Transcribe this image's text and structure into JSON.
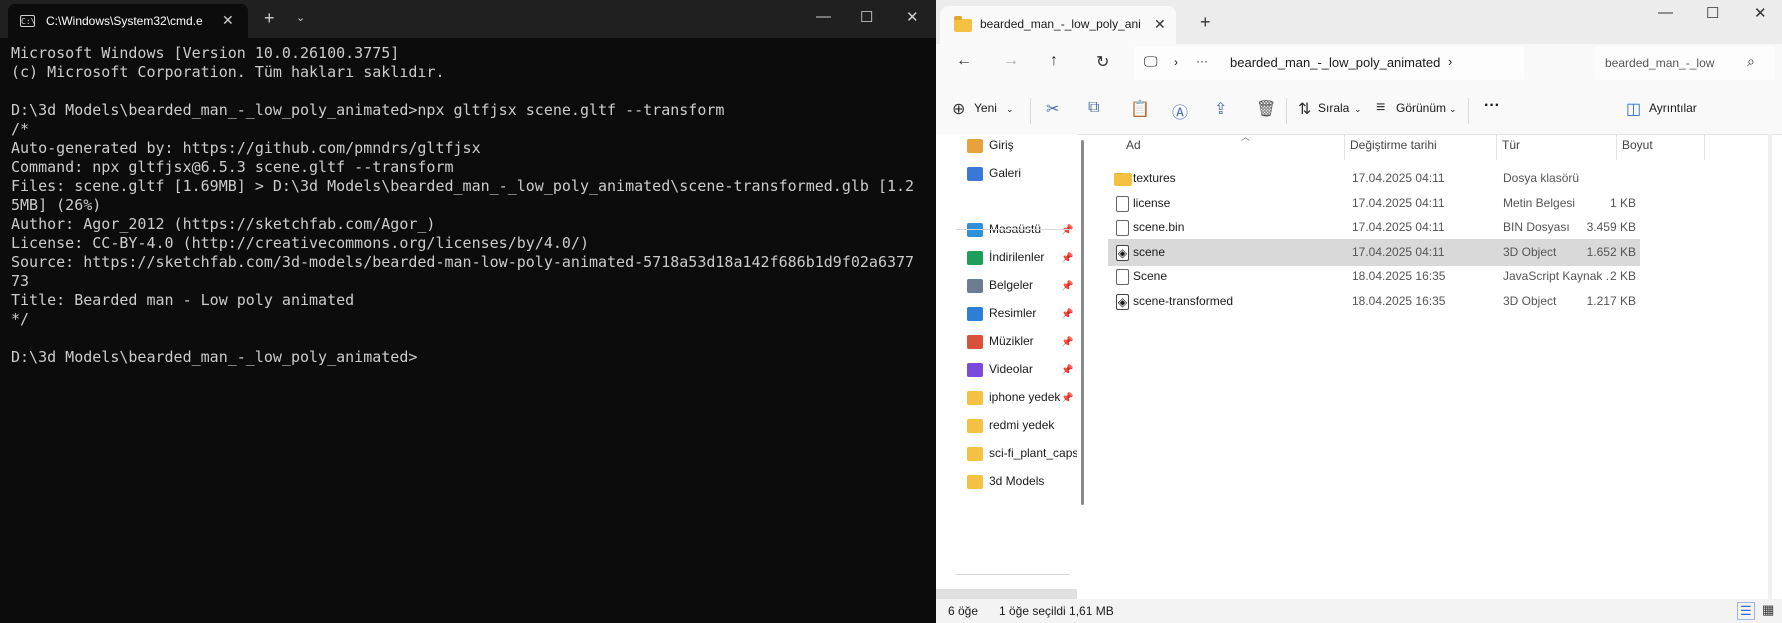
{
  "terminal": {
    "tab_title": "C:\\Windows\\System32\\cmd.e",
    "lines": [
      "Microsoft Windows [Version 10.0.26100.3775]",
      "(c) Microsoft Corporation. Tüm hakları saklıdır.",
      "",
      "D:\\3d Models\\bearded_man_-_low_poly_animated>npx gltfjsx scene.gltf --transform",
      "/*",
      "Auto-generated by: https://github.com/pmndrs/gltfjsx",
      "Command: npx gltfjsx@6.5.3 scene.gltf --transform",
      "Files: scene.gltf [1.69MB] > D:\\3d Models\\bearded_man_-_low_poly_animated\\scene-transformed.glb [1.2",
      "5MB] (26%)",
      "Author: Agor_2012 (https://sketchfab.com/Agor_)",
      "License: CC-BY-4.0 (http://creativecommons.org/licenses/by/4.0/)",
      "Source: https://sketchfab.com/3d-models/bearded-man-low-poly-animated-5718a53d18a142f686b1d9f02a6377",
      "73",
      "Title: Bearded man - Low poly animated",
      "*/",
      "",
      "D:\\3d Models\\bearded_man_-_low_poly_animated>"
    ]
  },
  "explorer": {
    "tab_title": "bearded_man_-_low_poly_anin",
    "breadcrumb": "bearded_man_-_low_poly_animated",
    "breadcrumb_more": "···",
    "search_placeholder": "bearded_man_-_low",
    "commands": {
      "new": "Yeni",
      "sort": "Sırala",
      "view": "Görünüm",
      "more": "···",
      "details": "Ayrıntılar"
    },
    "nav": [
      {
        "label": "Giriş",
        "icon": "home-icon",
        "color": "#e8a23c",
        "pinned": false
      },
      {
        "label": "Galeri",
        "icon": "gallery-icon",
        "color": "#3a78d8",
        "pinned": false
      },
      {
        "label": "Masaüstü",
        "icon": "desktop-icon",
        "color": "#2f8fd8",
        "pinned": true
      },
      {
        "label": "İndirilenler",
        "icon": "downloads-icon",
        "color": "#1f9e5a",
        "pinned": true
      },
      {
        "label": "Belgeler",
        "icon": "documents-icon",
        "color": "#6b7c93",
        "pinned": true
      },
      {
        "label": "Resimler",
        "icon": "pictures-icon",
        "color": "#2c7fd6",
        "pinned": true
      },
      {
        "label": "Müzikler",
        "icon": "music-icon",
        "color": "#d8523a",
        "pinned": true
      },
      {
        "label": "Videolar",
        "icon": "videos-icon",
        "color": "#7b4ad8",
        "pinned": true
      },
      {
        "label": "iphone yedek",
        "icon": "folder-icon",
        "color": "#f5c142",
        "pinned": true
      },
      {
        "label": "redmi yedek",
        "icon": "folder-icon",
        "color": "#f5c142",
        "pinned": false
      },
      {
        "label": "sci-fi_plant_caps",
        "icon": "folder-icon",
        "color": "#f5c142",
        "pinned": false
      },
      {
        "label": "3d Models",
        "icon": "folder-icon",
        "color": "#f5c142",
        "pinned": false
      }
    ],
    "columns": {
      "name": "Ad",
      "date": "Değiştirme tarihi",
      "type": "Tür",
      "size": "Boyut"
    },
    "files": [
      {
        "name": "textures",
        "date": "17.04.2025 04:11",
        "type": "Dosya klasörü",
        "size": "",
        "icon": "folder-icon",
        "selected": false
      },
      {
        "name": "license",
        "date": "17.04.2025 04:11",
        "type": "Metin Belgesi",
        "size": "1 KB",
        "icon": "text-file-icon",
        "selected": false
      },
      {
        "name": "scene.bin",
        "date": "17.04.2025 04:11",
        "type": "BIN Dosyası",
        "size": "3.459 KB",
        "icon": "file-icon",
        "selected": false
      },
      {
        "name": "scene",
        "date": "17.04.2025 04:11",
        "type": "3D Object",
        "size": "1.652 KB",
        "icon": "3d-object-icon",
        "selected": true
      },
      {
        "name": "Scene",
        "date": "18.04.2025 16:35",
        "type": "JavaScript Kaynak ...",
        "size": "2 KB",
        "icon": "js-file-icon",
        "selected": false
      },
      {
        "name": "scene-transformed",
        "date": "18.04.2025 16:35",
        "type": "3D Object",
        "size": "1.217 KB",
        "icon": "3d-object-icon",
        "selected": false
      }
    ],
    "status": {
      "count": "6 öğe",
      "selection": "1 öğe seçildi  1,61 MB"
    }
  }
}
